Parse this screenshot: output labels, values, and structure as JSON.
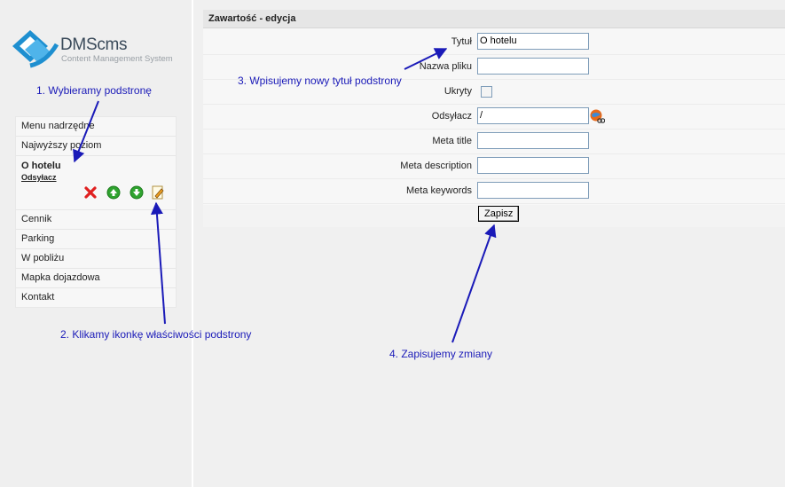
{
  "logo": {
    "name": "DMScms",
    "subtitle": "Content Management System"
  },
  "menu": {
    "items_top": [
      "Menu nadrzędne",
      "Najwyższy poziom"
    ],
    "selected": {
      "title": "O hotelu",
      "subtitle": "Odsyłacz"
    },
    "items_bottom": [
      "Cennik",
      "Parking",
      "W pobliżu",
      "Mapka dojazdowa",
      "Kontakt"
    ],
    "icons": [
      "delete-icon",
      "move-up-icon",
      "move-down-icon",
      "edit-properties-icon"
    ]
  },
  "panel": {
    "header": "Zawartość - edycja",
    "fields": {
      "title_label": "Tytuł",
      "title_value": "O hotelu",
      "filename_label": "Nazwa pliku",
      "filename_value": "",
      "hidden_label": "Ukryty",
      "link_label": "Odsyłacz",
      "link_value": "/",
      "meta_title_label": "Meta title",
      "meta_title_value": "",
      "meta_desc_label": "Meta description",
      "meta_desc_value": "",
      "meta_kw_label": "Meta keywords",
      "meta_kw_value": ""
    },
    "save_label": "Zapisz"
  },
  "annotations": {
    "step1": "1. Wybieramy podstronę",
    "step2": "2. Klikamy ikonkę właściwości podstrony",
    "step3": "3. Wpisujemy nowy tytuł podstrony",
    "step4": "4. Zapisujemy zmiany"
  },
  "colors": {
    "annotation": "#1a1ab8",
    "background": "#f0f0f0",
    "header": "#e6e6e6"
  }
}
